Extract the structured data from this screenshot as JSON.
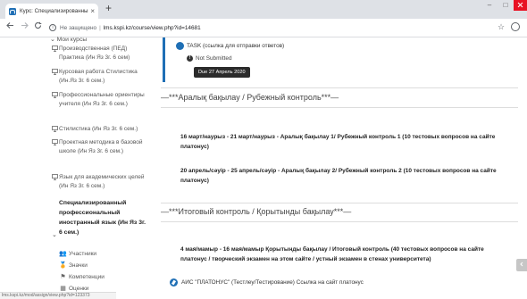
{
  "browser": {
    "tab_title": "Курс: Специализированный пр",
    "tab_close": "×",
    "new_tab": "+",
    "url_security": "Не защищено",
    "url_separator": "|",
    "url_text": "lms.kspi.kz/course/view.php?id=14681",
    "window": {
      "minimize": "–",
      "maximize": "□"
    }
  },
  "sidebar": {
    "header": "Мои курсы",
    "courses": [
      {
        "label": "Производственная (ПЕД) Практика (Ин Яз 3г. 6 сем)"
      },
      {
        "label": "Курсовая работа Стилистика (Ин.Яз 3г. 6 сем.)"
      },
      {
        "label": "Профессиональные ориентиры учителя (Ин Яз 3г. 6 сем.)"
      },
      {
        "label": "Стилистика (Ин Яз 3г. 6 сем.)"
      },
      {
        "label": "Проектная методика в базовой школе (Ин Яз 3г. 6 сем.)"
      },
      {
        "label": "Язык для академических целей (Ин Яз 3г. 6 сем.)"
      }
    ],
    "current_course": "Специализированный профессиональный иностранный язык (Ин Яз 3г. 6 сем.)",
    "sub_items": [
      {
        "label": "Участники",
        "icon": "participants-icon"
      },
      {
        "label": "Значки",
        "icon": "badges-icon"
      },
      {
        "label": "Компетенции",
        "icon": "competencies-icon"
      },
      {
        "label": "Оценки",
        "icon": "grades-icon"
      }
    ]
  },
  "status_bar": "lms.kspi.kz/mod/assign/view.php?id=123373",
  "main": {
    "assignment": {
      "title": "TASK (ссылка для отправки ответов)",
      "status": "Not Submitted",
      "due": "Due 27 Апрель 2020"
    },
    "sections": [
      {
        "title": "—***Аралық бақылау / Рубежный контроль***—",
        "items": [
          "16 март/наурыз - 21 март/наурыз - Аралық бақылау 1/ Рубежный контроль 1 (10 тестовых вопросов на сайте платонус)",
          "20 апрель/сәуір - 25 апрель/сәуір - Аралық бақылау 2/ Рубежный контроль 2 (10 тестовых вопросов на сайте платонус)"
        ]
      },
      {
        "title": "—***Итоговый контроль / Қорытынды бақылау***—",
        "items": [
          "4 мая/мамыр - 16 мая/мамыр Қорытынды бақылау / Итоговый контроль (40 тестовых вопросов на сайте платонус / творческий экзамен на этом сайте / устный экзамен в стенах университета)"
        ]
      }
    ],
    "ais_link": "АИС \"ПЛАТОНУС\" (Тестлеу/Тестирование) Ссылка на сайт платонус"
  },
  "colors": {
    "accent": "#1f6fb5",
    "due_badge": "#2b2b2b",
    "close_button": "#e81123"
  }
}
